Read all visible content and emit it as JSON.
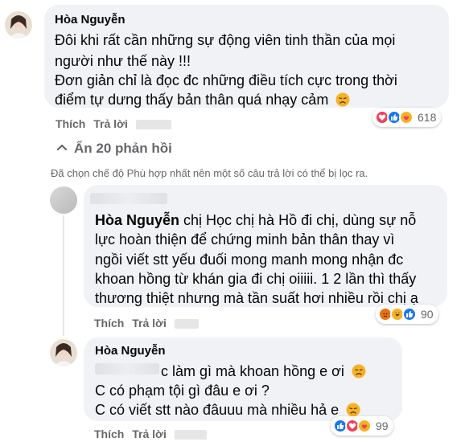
{
  "comment1": {
    "author": "Hòa Nguyễn",
    "lines": [
      "Đôi khi rất cần những sự động viên tinh thần của mọi",
      "người như thế này !!!",
      "Đơn giản chỉ là đọc đc những điều tích cực trong thời",
      "điểm tự dưng thấy bản thân quá nhạy cảm"
    ],
    "like_label": "Thích",
    "reply_label": "Trả lời",
    "reaction_count": "618",
    "reactions": [
      "love-icon",
      "like-icon",
      "care-icon"
    ]
  },
  "hide_replies": {
    "label": "Ẩn 20 phản hồi",
    "icon": "chevron-up-icon"
  },
  "filter_notice": "Đã chọn chế độ Phù hợp nhất nên một số câu trả lời có thể bị lọc ra.",
  "reply1": {
    "mention": "Hòa Nguyễn",
    "first_line_rest": " chị Học chị hà Hồ đi chị, dùng sự nỗ",
    "lines": [
      "lực hoàn thiện để chứng minh bản thân thay vì",
      "ngồi viết stt yếu đuối mong manh mong nhận đc",
      "khoan hồng từ khán gia đi chị oiiiii. 1 2 lần thì thấy",
      "thương thiệt nhưng mà tần suất hơi nhiều rồi chị ạ"
    ],
    "like_label": "Thích",
    "reply_label": "Trả lời",
    "reaction_count": "90",
    "reactions": [
      "angry-icon",
      "haha-icon",
      "like-icon"
    ]
  },
  "reply2": {
    "author": "Hòa Nguyễn",
    "first_line_rest": "c làm gì mà khoan hồng e ơi",
    "lines": [
      "C có phạm tội gì đâu e ơi ?",
      "C có viết stt nào đâuuu mà nhiều hả e"
    ],
    "like_label": "Thích",
    "reply_label": "Trả lời",
    "reaction_count": "99",
    "reactions": [
      "like-icon",
      "love-icon",
      "care-icon"
    ]
  },
  "colors": {
    "bubble": "#f0f2f5",
    "secondary_text": "#65676b",
    "like_blue": "#1877f2",
    "love_red": "#f33e58",
    "emoji_yellow": "#f7b125"
  }
}
